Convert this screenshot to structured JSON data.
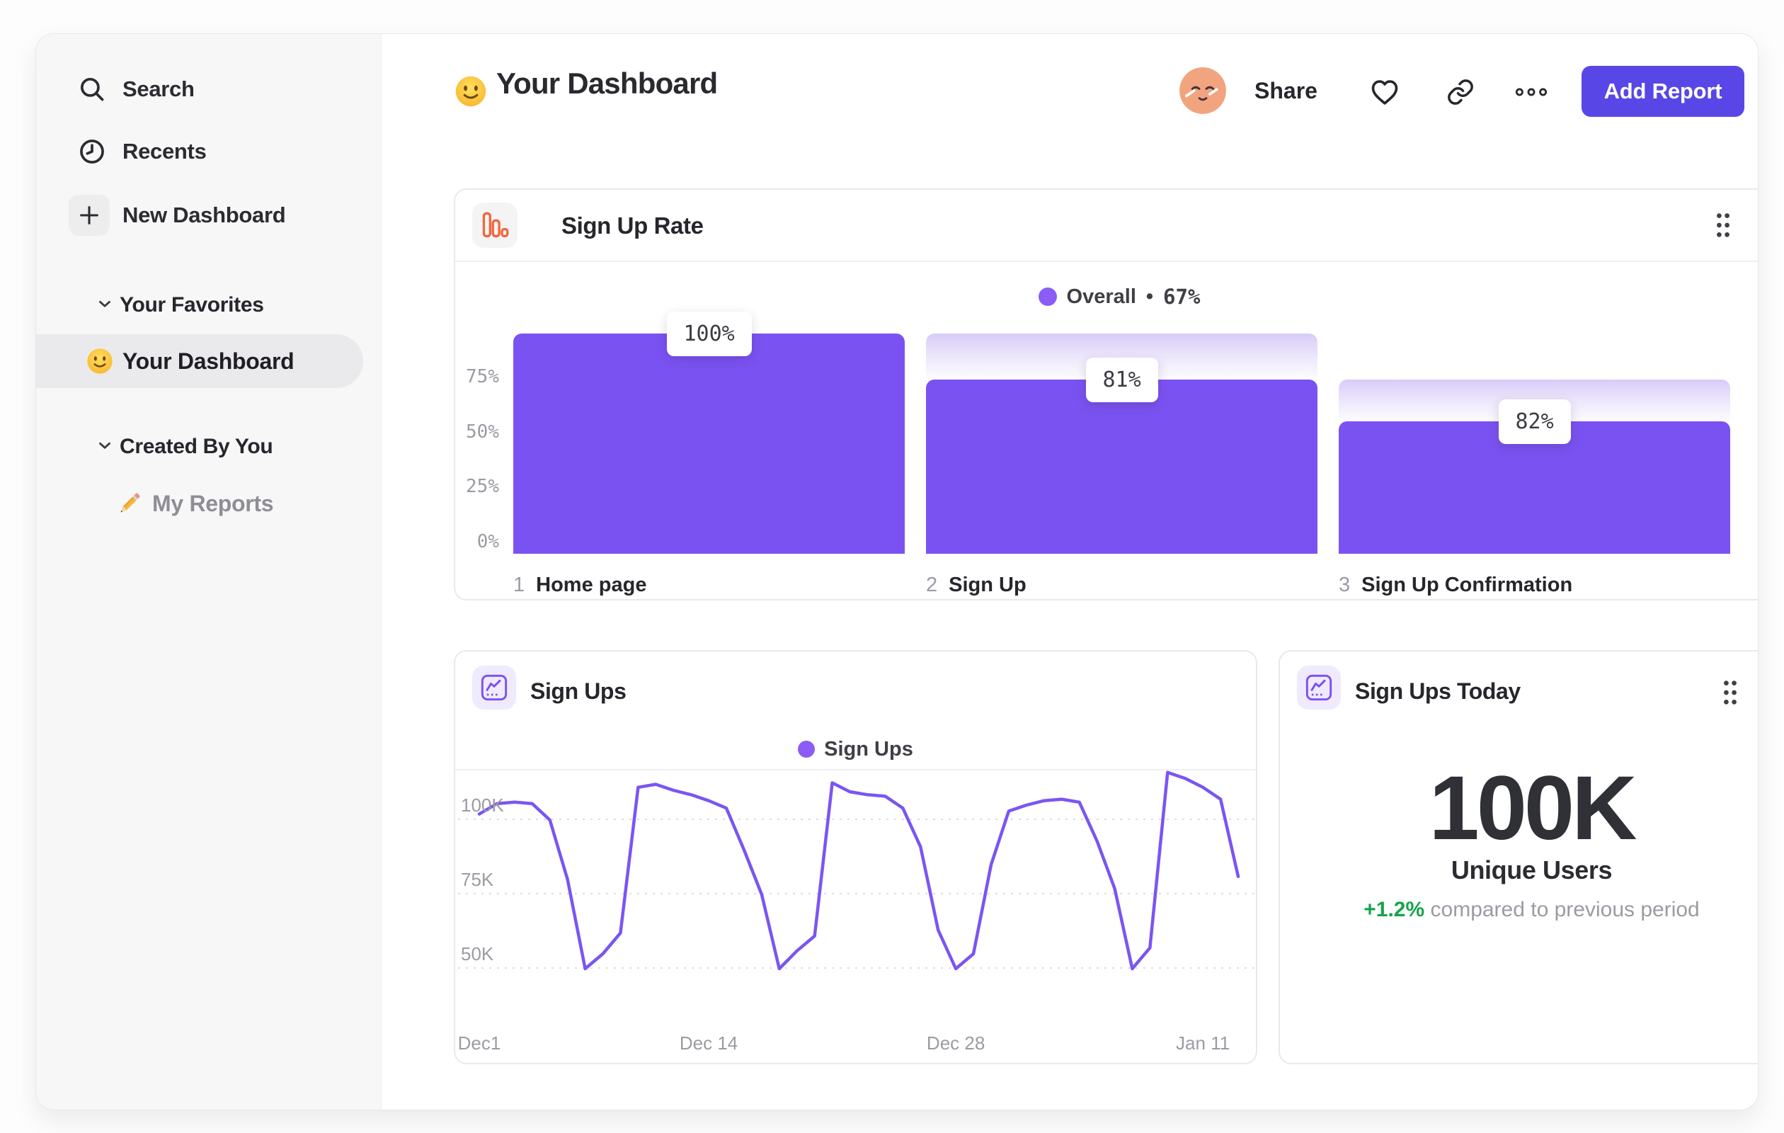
{
  "sidebar": {
    "items": [
      {
        "label": "Search",
        "icon": "search-icon"
      },
      {
        "label": "Recents",
        "icon": "clock-icon"
      },
      {
        "label": "New Dashboard",
        "icon": "plus-icon"
      }
    ],
    "sections": [
      {
        "label": "Your Favorites",
        "items": [
          {
            "label": "Your Dashboard",
            "emoji": "smiley",
            "selected": true
          }
        ]
      },
      {
        "label": "Created By You",
        "items": [
          {
            "label": "My Reports",
            "emoji": "pencil",
            "selected": false
          }
        ]
      }
    ]
  },
  "header": {
    "title": "Your Dashboard",
    "share_label": "Share",
    "add_report_label": "Add Report"
  },
  "cards": {
    "signup_rate": {
      "title": "Sign Up Rate",
      "legend": {
        "label": "Overall",
        "separator": "•",
        "value": "67%"
      },
      "chart_data": {
        "type": "bar",
        "subtype": "funnel",
        "title": "Sign Up Rate",
        "overall_conversion_pct": 67,
        "y_ticks": [
          "75%",
          "50%",
          "25%",
          "0%"
        ],
        "ylim": [
          0,
          100
        ],
        "grid": false,
        "legend_position": "top-center",
        "bar_color": "#7b52f2",
        "steps": [
          {
            "index": "1",
            "label": "Home page",
            "badge": "100%",
            "conversion_from_prev_pct": 100,
            "render_cum_frac": 1.0,
            "render_prev_frac": 1.0
          },
          {
            "index": "2",
            "label": "Sign Up",
            "badge": "81%",
            "conversion_from_prev_pct": 81,
            "render_cum_frac": 0.79,
            "render_prev_frac": 1.0
          },
          {
            "index": "3",
            "label": "Sign Up Confirmation",
            "badge": "82%",
            "conversion_from_prev_pct": 82,
            "render_cum_frac": 0.6,
            "render_prev_frac": 0.79
          }
        ]
      }
    },
    "sign_ups": {
      "title": "Sign Ups",
      "legend": {
        "label": "Sign Ups"
      },
      "chart_data": {
        "type": "line",
        "title": "Sign Ups",
        "unit": "K",
        "line_color": "#7a55f2",
        "grid": "dashed-horizontal",
        "legend_position": "top-center",
        "y_ticks": [
          {
            "label": "100K",
            "value": 100
          },
          {
            "label": "75K",
            "value": 75
          },
          {
            "label": "50K",
            "value": 50
          }
        ],
        "x_ticks": [
          {
            "label": "Dec1",
            "day": 0
          },
          {
            "label": "Dec 14",
            "day": 13
          },
          {
            "label": "Dec 28",
            "day": 27
          },
          {
            "label": "Jan 11",
            "day": 41
          }
        ],
        "values_k": [
          97,
          100.5,
          101,
          100.5,
          95,
          75,
          45,
          50,
          57,
          106,
          107,
          105,
          103.5,
          101.5,
          99,
          85,
          70,
          45,
          51,
          56,
          107.5,
          104.5,
          103.5,
          103,
          99,
          86,
          58,
          45,
          50,
          80,
          98,
          100,
          101.5,
          102,
          101,
          88,
          72,
          45,
          52,
          111,
          109,
          106,
          102,
          76
        ]
      }
    },
    "sign_ups_today": {
      "title": "Sign Ups Today",
      "value": "100K",
      "value_label": "Unique Users",
      "delta": "+1.2%",
      "delta_note": "compared to previous period"
    }
  },
  "colors": {
    "accent_purple": "#7b52f2",
    "legend_dot": "#8b5cf6",
    "button_indigo": "#5847e6",
    "positive_green": "#16a34a",
    "icon_orange": "#f1673d",
    "avatar_peach": "#f1a47e"
  }
}
